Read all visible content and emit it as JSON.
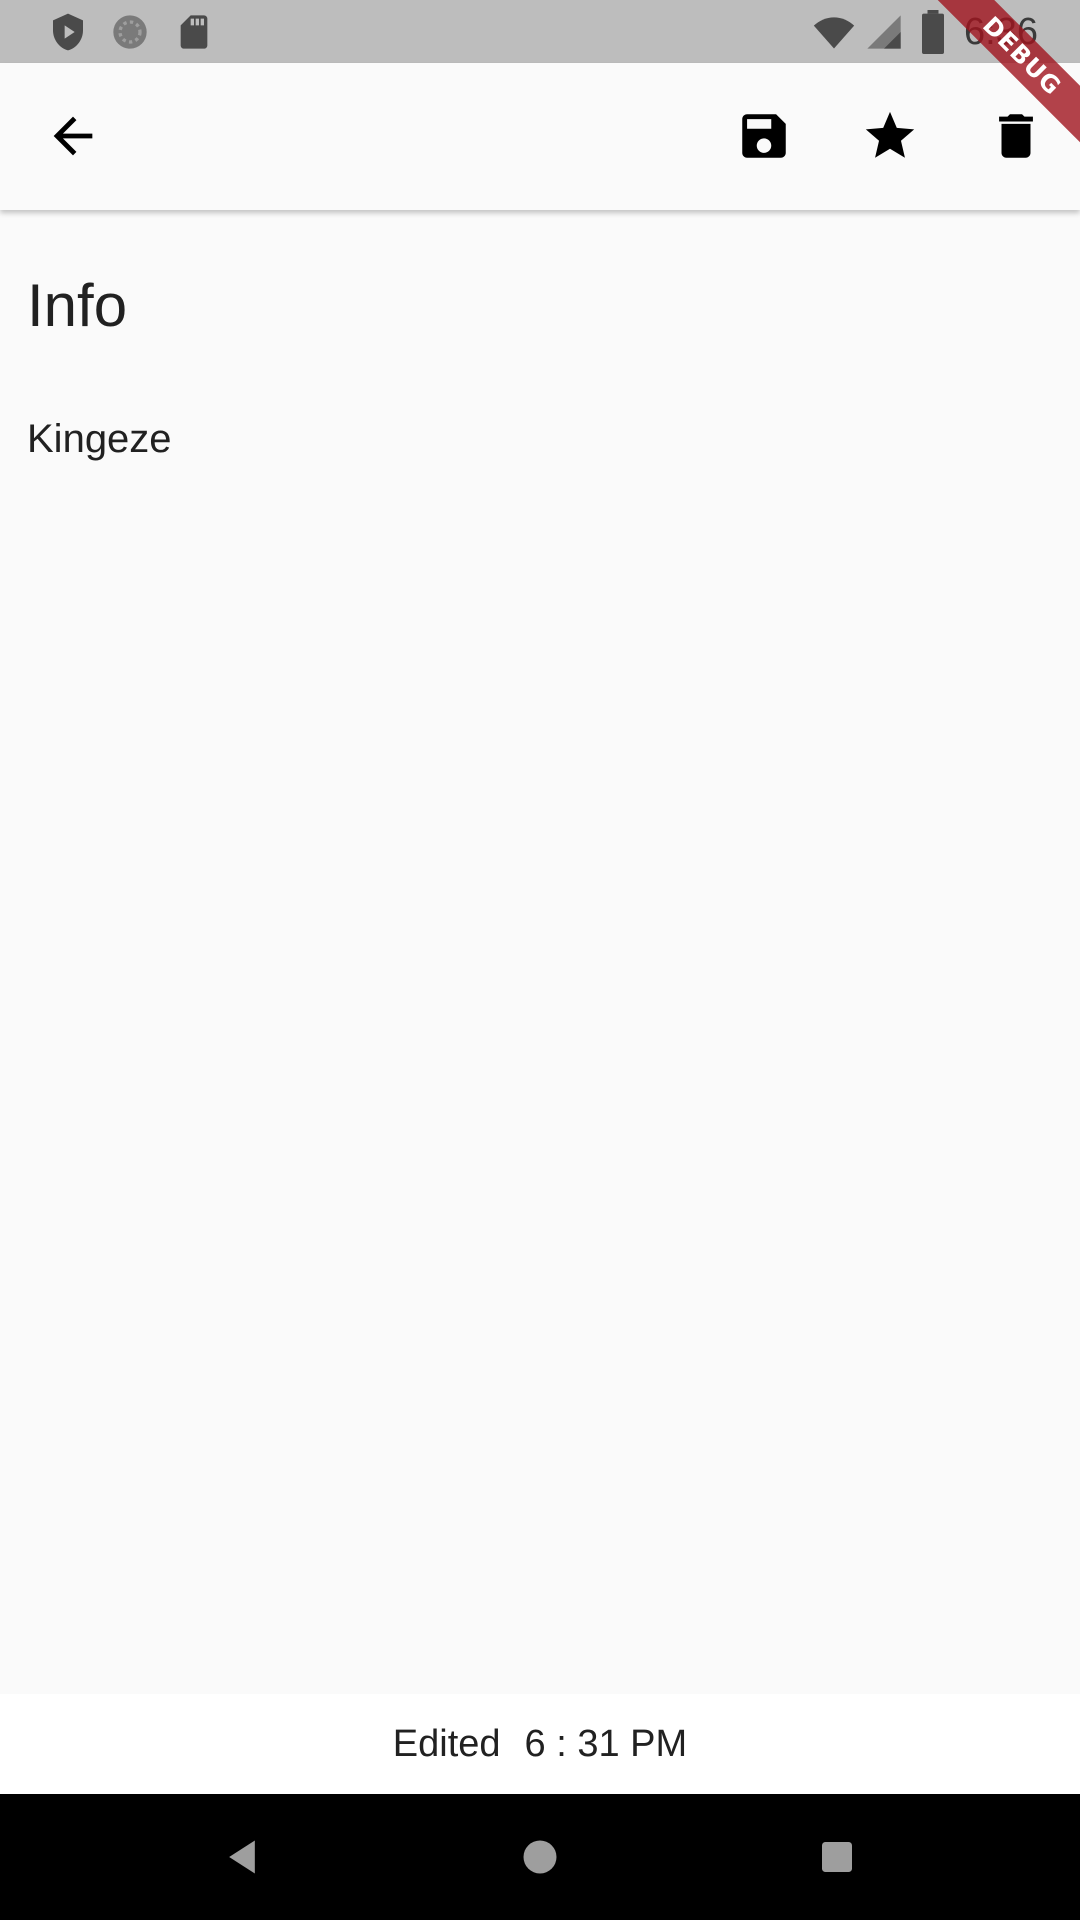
{
  "status_bar": {
    "time": "6:36",
    "left_icons": [
      "shield-play-icon",
      "sync-circle-icon",
      "sd-card-icon"
    ],
    "right_icons": [
      "wifi-icon",
      "cell-signal-icon",
      "battery-icon"
    ]
  },
  "app_bar": {
    "actions": [
      "back-arrow-icon",
      "save-icon",
      "star-icon",
      "delete-icon"
    ]
  },
  "debug_banner": {
    "label": "DEBUG"
  },
  "note": {
    "title": "Info",
    "body": "Kingeze"
  },
  "footer": {
    "edited_label": "Edited",
    "edited_time": "6 : 31 PM"
  },
  "colors": {
    "status_bar": "#bdbdbd",
    "background": "#fafafa",
    "text": "#212121",
    "debug_banner": "#a0141e",
    "nav_bar": "#000000"
  }
}
